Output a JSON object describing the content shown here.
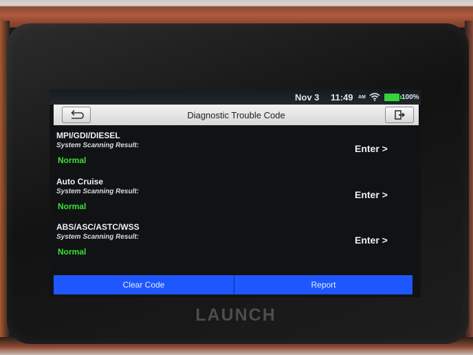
{
  "device": {
    "brand": "LAUNCH"
  },
  "status_bar": {
    "date": "Nov 3",
    "time": "11:49",
    "ampm": "AM",
    "battery": "100%"
  },
  "header": {
    "title": "Diagnostic Trouble Code"
  },
  "systems": [
    {
      "name": "MPI/GDI/DIESEL",
      "label": "System Scanning Result:",
      "result": "Normal",
      "action": "Enter >"
    },
    {
      "name": "Auto Cruise",
      "label": "System Scanning Result:",
      "result": "Normal",
      "action": "Enter >"
    },
    {
      "name": "ABS/ASC/ASTC/WSS",
      "label": "System Scanning Result:",
      "result": "Normal",
      "action": "Enter >"
    }
  ],
  "actions": {
    "clear_code": "Clear Code",
    "report": "Report"
  },
  "colors": {
    "accent": "#1f57ff",
    "normal_status": "#38e236",
    "battery": "#36d33c"
  }
}
